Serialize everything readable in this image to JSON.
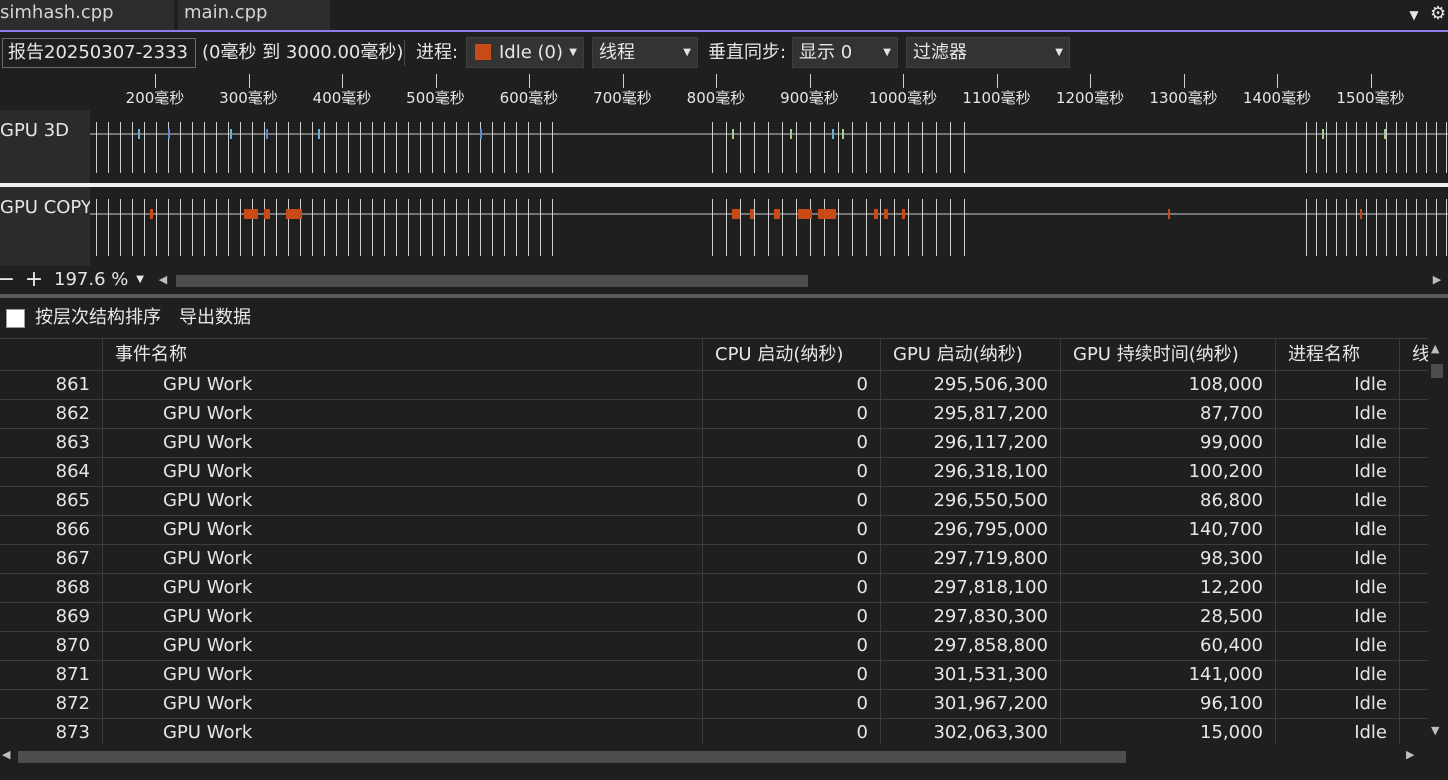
{
  "tabs": [
    {
      "label": "simhash.cpp"
    },
    {
      "label": "main.cpp"
    }
  ],
  "toolbar": {
    "report_name": "报告20250307-2333",
    "range": "(0毫秒 到 3000.00毫秒)",
    "process_label": "进程:",
    "process_value": "Idle (0)",
    "thread_value": "线程",
    "vsync_label": "垂直同步:",
    "vsync_value": "显示 0",
    "filter_value": "过滤器"
  },
  "timeline": {
    "ruler_ticks": [
      "200毫秒",
      "300毫秒",
      "400毫秒",
      "500毫秒",
      "600毫秒",
      "700毫秒",
      "800毫秒",
      "900毫秒",
      "1000毫秒",
      "1100毫秒",
      "1200毫秒",
      "1300毫秒",
      "1400毫秒",
      "1500毫秒"
    ],
    "tracks": [
      {
        "label": "GPU 3D"
      },
      {
        "label": "GPU COPY"
      }
    ],
    "zoom": "197.6 %",
    "colors": {
      "copy_event": "#c84a14",
      "track_line": "#c8c8c8",
      "event_tick": "#d0d0d0",
      "accent": "#8f7ce8"
    }
  },
  "options": {
    "hierarchy_sort_label": "按层次结构排序",
    "export_label": "导出数据"
  },
  "table": {
    "columns": [
      "",
      "事件名称",
      "CPU 启动(纳秒)",
      "GPU 启动(纳秒)",
      "GPU 持续时间(纳秒)",
      "进程名称",
      "线"
    ],
    "rows": [
      {
        "idx": "861",
        "name": "GPU Work",
        "cpu": "0",
        "gpu_start": "295,506,300",
        "gpu_dur": "108,000",
        "proc": "Idle"
      },
      {
        "idx": "862",
        "name": "GPU Work",
        "cpu": "0",
        "gpu_start": "295,817,200",
        "gpu_dur": "87,700",
        "proc": "Idle"
      },
      {
        "idx": "863",
        "name": "GPU Work",
        "cpu": "0",
        "gpu_start": "296,117,200",
        "gpu_dur": "99,000",
        "proc": "Idle"
      },
      {
        "idx": "864",
        "name": "GPU Work",
        "cpu": "0",
        "gpu_start": "296,318,100",
        "gpu_dur": "100,200",
        "proc": "Idle"
      },
      {
        "idx": "865",
        "name": "GPU Work",
        "cpu": "0",
        "gpu_start": "296,550,500",
        "gpu_dur": "86,800",
        "proc": "Idle"
      },
      {
        "idx": "866",
        "name": "GPU Work",
        "cpu": "0",
        "gpu_start": "296,795,000",
        "gpu_dur": "140,700",
        "proc": "Idle"
      },
      {
        "idx": "867",
        "name": "GPU Work",
        "cpu": "0",
        "gpu_start": "297,719,800",
        "gpu_dur": "98,300",
        "proc": "Idle"
      },
      {
        "idx": "868",
        "name": "GPU Work",
        "cpu": "0",
        "gpu_start": "297,818,100",
        "gpu_dur": "12,200",
        "proc": "Idle"
      },
      {
        "idx": "869",
        "name": "GPU Work",
        "cpu": "0",
        "gpu_start": "297,830,300",
        "gpu_dur": "28,500",
        "proc": "Idle"
      },
      {
        "idx": "870",
        "name": "GPU Work",
        "cpu": "0",
        "gpu_start": "297,858,800",
        "gpu_dur": "60,400",
        "proc": "Idle"
      },
      {
        "idx": "871",
        "name": "GPU Work",
        "cpu": "0",
        "gpu_start": "301,531,300",
        "gpu_dur": "141,000",
        "proc": "Idle"
      },
      {
        "idx": "872",
        "name": "GPU Work",
        "cpu": "0",
        "gpu_start": "301,967,200",
        "gpu_dur": "96,100",
        "proc": "Idle"
      },
      {
        "idx": "873",
        "name": "GPU Work",
        "cpu": "0",
        "gpu_start": "302,063,300",
        "gpu_dur": "15,000",
        "proc": "Idle"
      }
    ]
  },
  "icons": {
    "tab_menu": "chevron-down-icon",
    "settings": "gear-icon",
    "zoom_out": "minus-icon",
    "zoom_in": "plus-icon"
  }
}
